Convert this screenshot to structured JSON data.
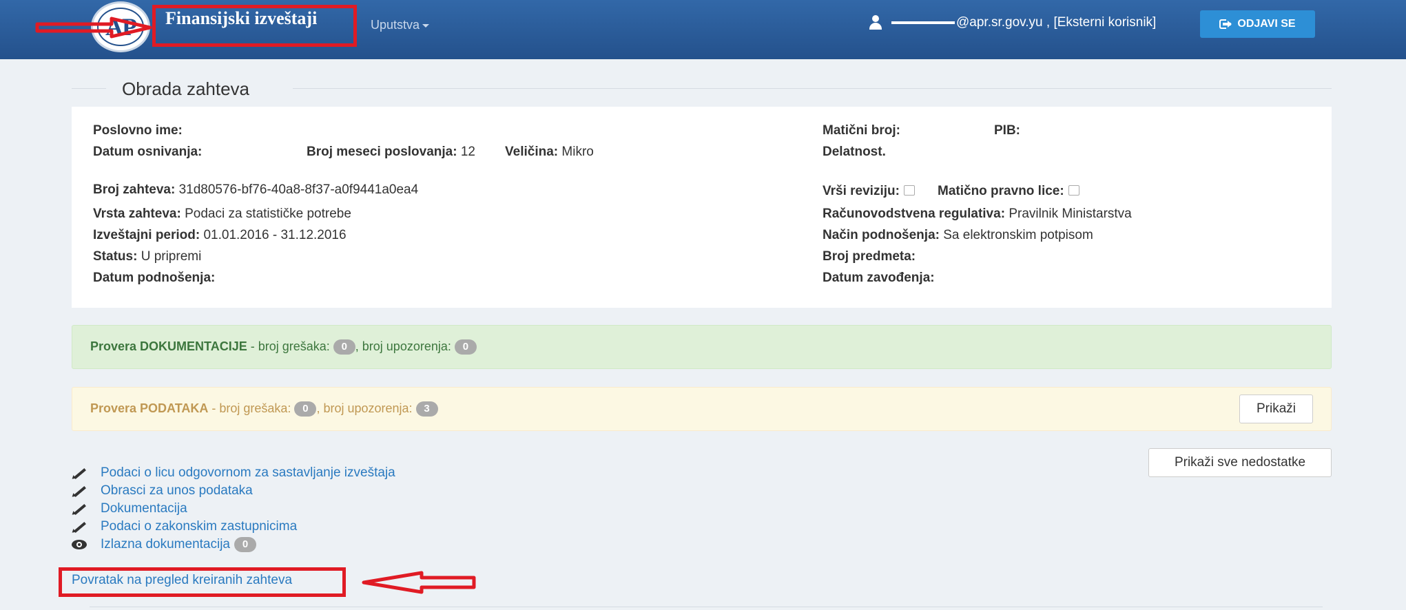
{
  "header": {
    "logo_text": "AP",
    "brand": "Finansijski izveštaji",
    "menu_uputstva": "Uputstva",
    "user_suffix": "@apr.sr.gov.yu , [Eksterni korisnik]",
    "logout_label": "ODJAVI SE",
    "colors": {
      "navbar": "#24518c",
      "logout": "#2d8fd6"
    }
  },
  "section_title": "Obrada zahteva",
  "info": {
    "poslovno_ime_label": "Poslovno ime:",
    "datum_osnivanja_label": "Datum osnivanja:",
    "broj_meseci_label": "Broj meseci poslovanja:",
    "broj_meseci_value": "12",
    "velicina_label": "Veličina:",
    "velicina_value": "Mikro",
    "maticni_broj_label": "Matični broj:",
    "pib_label": "PIB:",
    "delatnost_label": "Delatnost.",
    "broj_zahteva_label": "Broj zahteva:",
    "broj_zahteva_value": "31d80576-bf76-40a8-8f37-a0f9441a0ea4",
    "vrsta_zahteva_label": "Vrsta zahteva:",
    "vrsta_zahteva_value": "Podaci za statističke potrebe",
    "izvestajni_period_label": "Izveštajni period:",
    "izvestajni_period_value": "01.01.2016 - 31.12.2016",
    "status_label": "Status:",
    "status_value": "U pripremi",
    "datum_podnosenja_label": "Datum podnošenja:",
    "vrsi_reviziju_label": "Vrši reviziju:",
    "maticno_pravno_lice_label": "Matično pravno lice:",
    "racunovodstvena_label": "Računovodstvena regulativa:",
    "racunovodstvena_value": "Pravilnik Ministarstva",
    "nacin_podnosenja_label": "Način podnošenja:",
    "nacin_podnosenja_value": "Sa elektronskim potpisom",
    "broj_predmeta_label": "Broj predmeta:",
    "datum_zavodjenja_label": "Datum zavođenja:"
  },
  "checks": {
    "dokumentacija": {
      "title": "Provera DOKUMENTACIJE",
      "errors_text": " - broj grešaka: ",
      "errors": "0",
      "warnings_text": ", broj upozorenja: ",
      "warnings": "0"
    },
    "podaci": {
      "title": "Provera PODATAKA",
      "errors_text": " - broj grešaka: ",
      "errors": "0",
      "warnings_text": ", broj upozorenja: ",
      "warnings": "3",
      "button": "Prikaži"
    }
  },
  "show_all_button": "Prikaži sve nedostatke",
  "links": [
    "Podaci o licu odgovornom za sastavljanje izveštaja",
    "Obrasci za unos podataka",
    "Dokumentacija",
    "Podaci o zakonskim zastupnicima",
    "Izlazna dokumentacija"
  ],
  "izlazna_count": "0",
  "back_link": "Povratak na pregled kreiranih zahteva",
  "annotation_color": "#e01b24"
}
